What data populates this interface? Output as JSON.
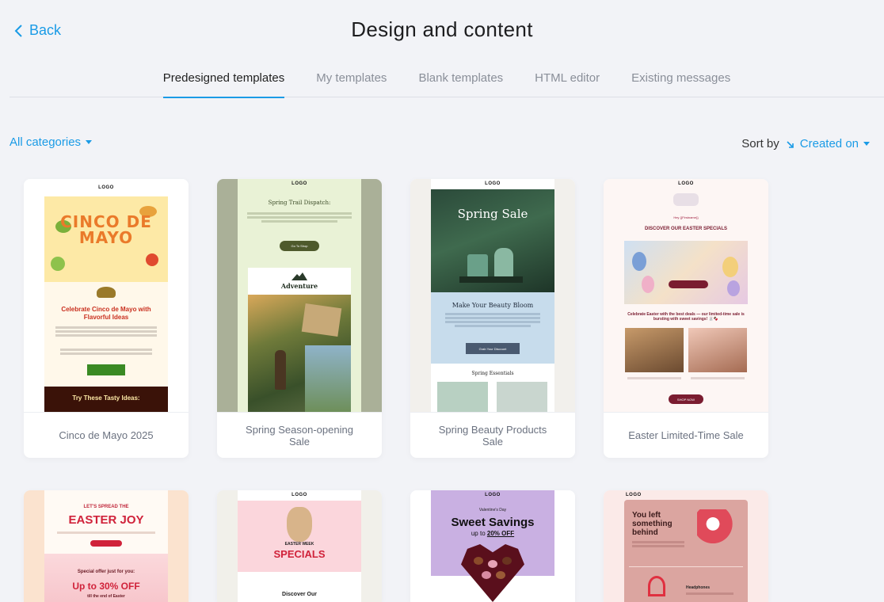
{
  "header": {
    "back_label": "Back",
    "title": "Design and content"
  },
  "tabs": [
    {
      "label": "Predesigned templates",
      "active": true
    },
    {
      "label": "My templates",
      "active": false
    },
    {
      "label": "Blank templates",
      "active": false
    },
    {
      "label": "HTML editor",
      "active": false
    },
    {
      "label": "Existing messages",
      "active": false
    }
  ],
  "filters": {
    "categories_label": "All categories",
    "sort_label": "Sort by",
    "sort_value": "Created on"
  },
  "colors": {
    "accent": "#1a9be6"
  },
  "templates": [
    {
      "name": "Cinco de Mayo 2025",
      "logo": "LOGO",
      "title_art": "CINCO DE MAYO",
      "headline": "Celebrate Cinco de Mayo with Flavorful Ideas",
      "section": "Try These Tasty Ideas:"
    },
    {
      "name": "Spring Season-opening Sale",
      "logo": "LOGO",
      "headline": "Spring Trail Dispatch:",
      "button": "Go To Shop",
      "brand": "Adventure"
    },
    {
      "name": "Spring Beauty Products Sale",
      "logo": "LOGO",
      "headline": "Spring Sale",
      "sub": "Make Your Beauty Bloom",
      "button": "Grab Your Discount",
      "section": "Spring Essentials"
    },
    {
      "name": "Easter Limited-Time Sale",
      "logo": "LOGO",
      "greeting": "Hey {{Firstname}}",
      "headline": "DISCOVER OUR EASTER SPECIALS",
      "sub": "Celebrate Easter with the best deals — our limited-time sale is bursting with sweet savings! 🐰🍫",
      "button": "SHOP NOW"
    },
    {
      "name": "",
      "headline_small": "LET'S SPREAD THE",
      "headline": "EASTER JOY",
      "offer": "Special offer just for you:",
      "discount": "Up to 30% OFF",
      "until": "till the end of Easter"
    },
    {
      "name": "",
      "logo": "LOGO",
      "week": "EASTER WEEK",
      "headline": "SPECIALS",
      "sub": "Discover Our"
    },
    {
      "name": "",
      "logo": "LOGO",
      "small": "Valentine's Day",
      "headline": "Sweet Savings",
      "up_to": "up to",
      "discount": "20% OFF"
    },
    {
      "name": "",
      "logo": "LOGO",
      "headline": "You left something behind",
      "product": "Headphones"
    }
  ]
}
